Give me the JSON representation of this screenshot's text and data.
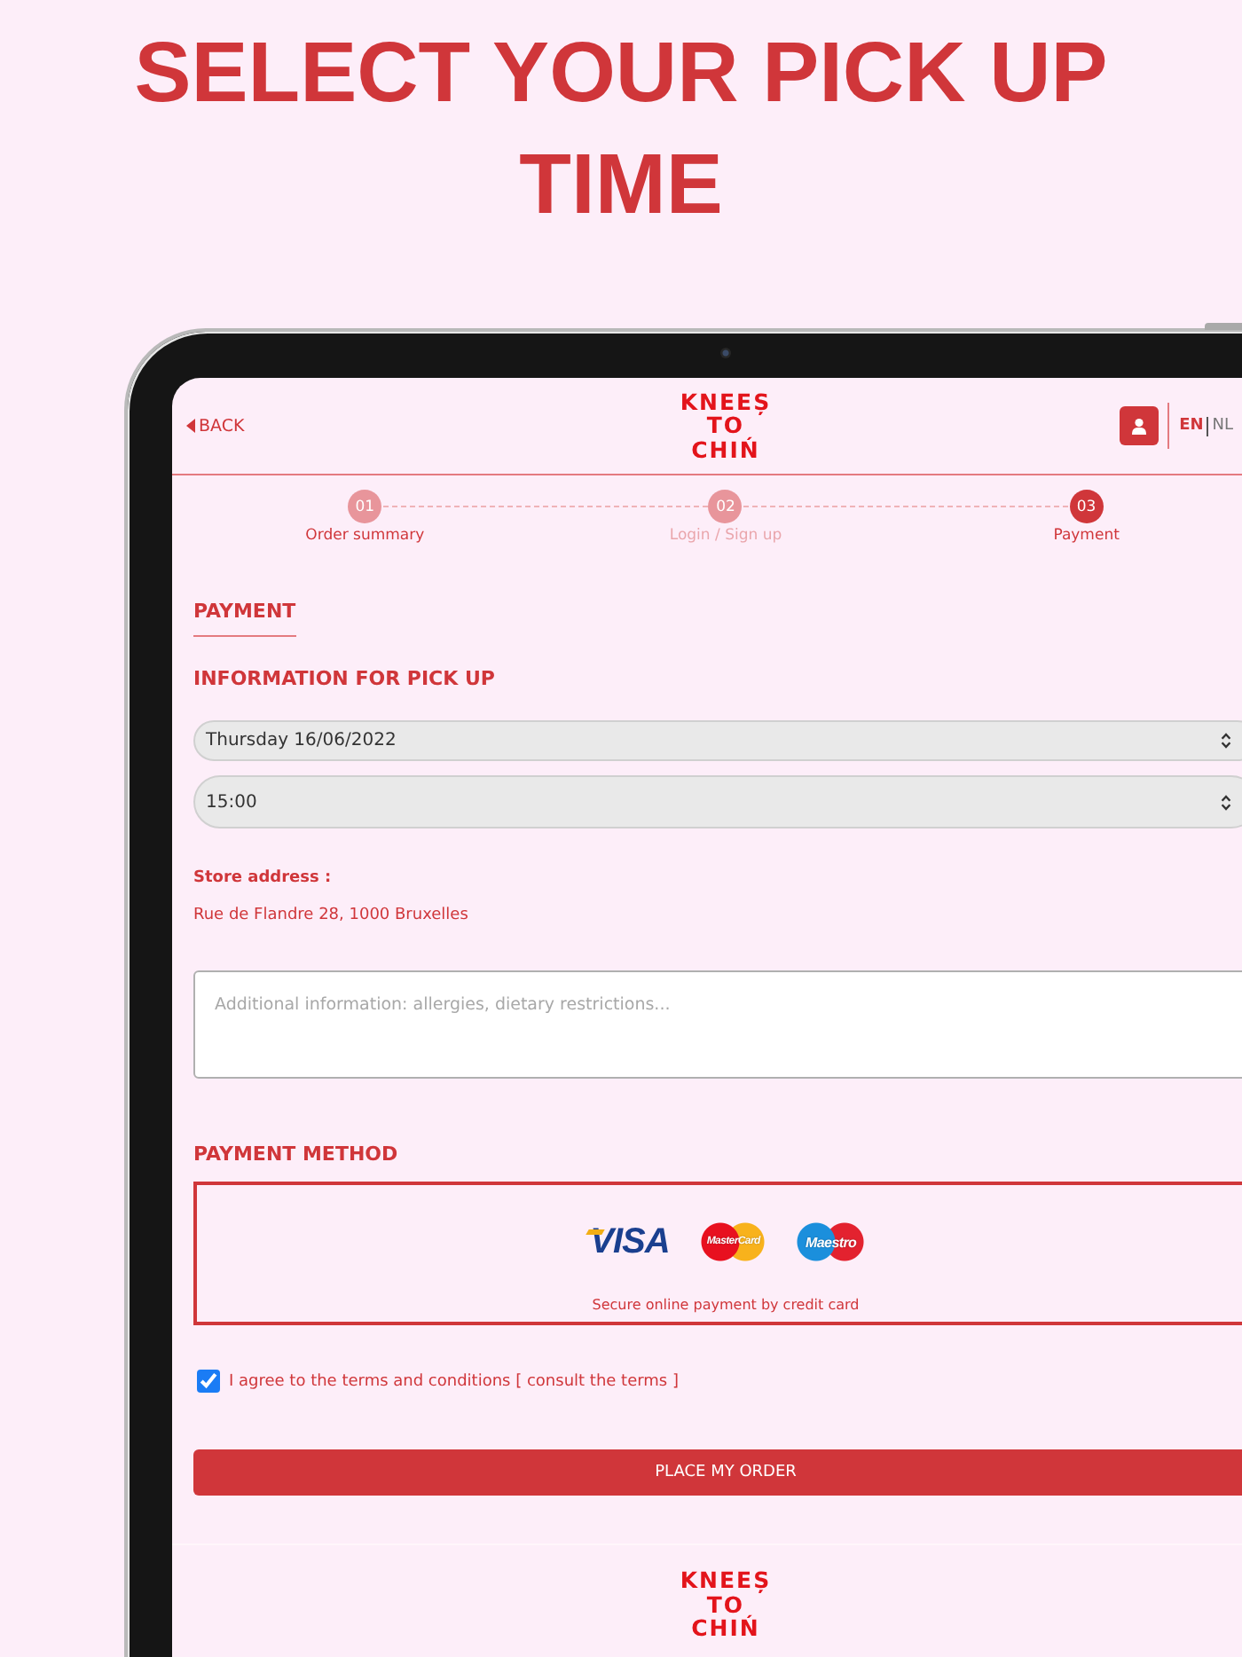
{
  "headline": "SELECT YOUR PICK UP TIME",
  "header": {
    "back": {
      "label": "BACK"
    },
    "logo": {
      "lines": [
        "KNEEȘ",
        "TO",
        "CHIŃ"
      ]
    },
    "languages": [
      {
        "label": "EN",
        "selected": true
      },
      {
        "label": "NL",
        "selected": false
      }
    ]
  },
  "steps": [
    {
      "number": "01",
      "label": "Order summary",
      "selected": false,
      "disabled": false
    },
    {
      "number": "02",
      "label": "Login / Sign up",
      "selected": false,
      "disabled": true
    },
    {
      "number": "03",
      "label": "Payment",
      "selected": true,
      "disabled": false
    }
  ],
  "section_title": "PAYMENT",
  "pickup": {
    "title": "INFORMATION FOR PICK UP",
    "date": {
      "value": "Thursday 16/06/2022"
    },
    "time": {
      "value": "15:00"
    },
    "store_label": "Store address :",
    "store_address": "Rue de Flandre 28, 1000 Bruxelles",
    "notes": {
      "placeholder": "Additional information: allergies, dietary restrictions..."
    }
  },
  "payment": {
    "title": "PAYMENT METHOD",
    "cards": [
      {
        "kind": "visa",
        "label": "VISA"
      },
      {
        "kind": "mastercard",
        "label": "MasterCard"
      },
      {
        "kind": "maestro",
        "label": "Maestro"
      }
    ],
    "caption": "Secure online payment by credit card"
  },
  "terms": {
    "checked": true,
    "label": "I agree to the terms and conditions",
    "link": "[ consult the terms ]"
  },
  "submit": {
    "label": "PLACE MY ORDER"
  },
  "footer": {
    "logo": {
      "lines": [
        "KNEEȘ",
        "TO",
        "CHIŃ"
      ]
    }
  }
}
